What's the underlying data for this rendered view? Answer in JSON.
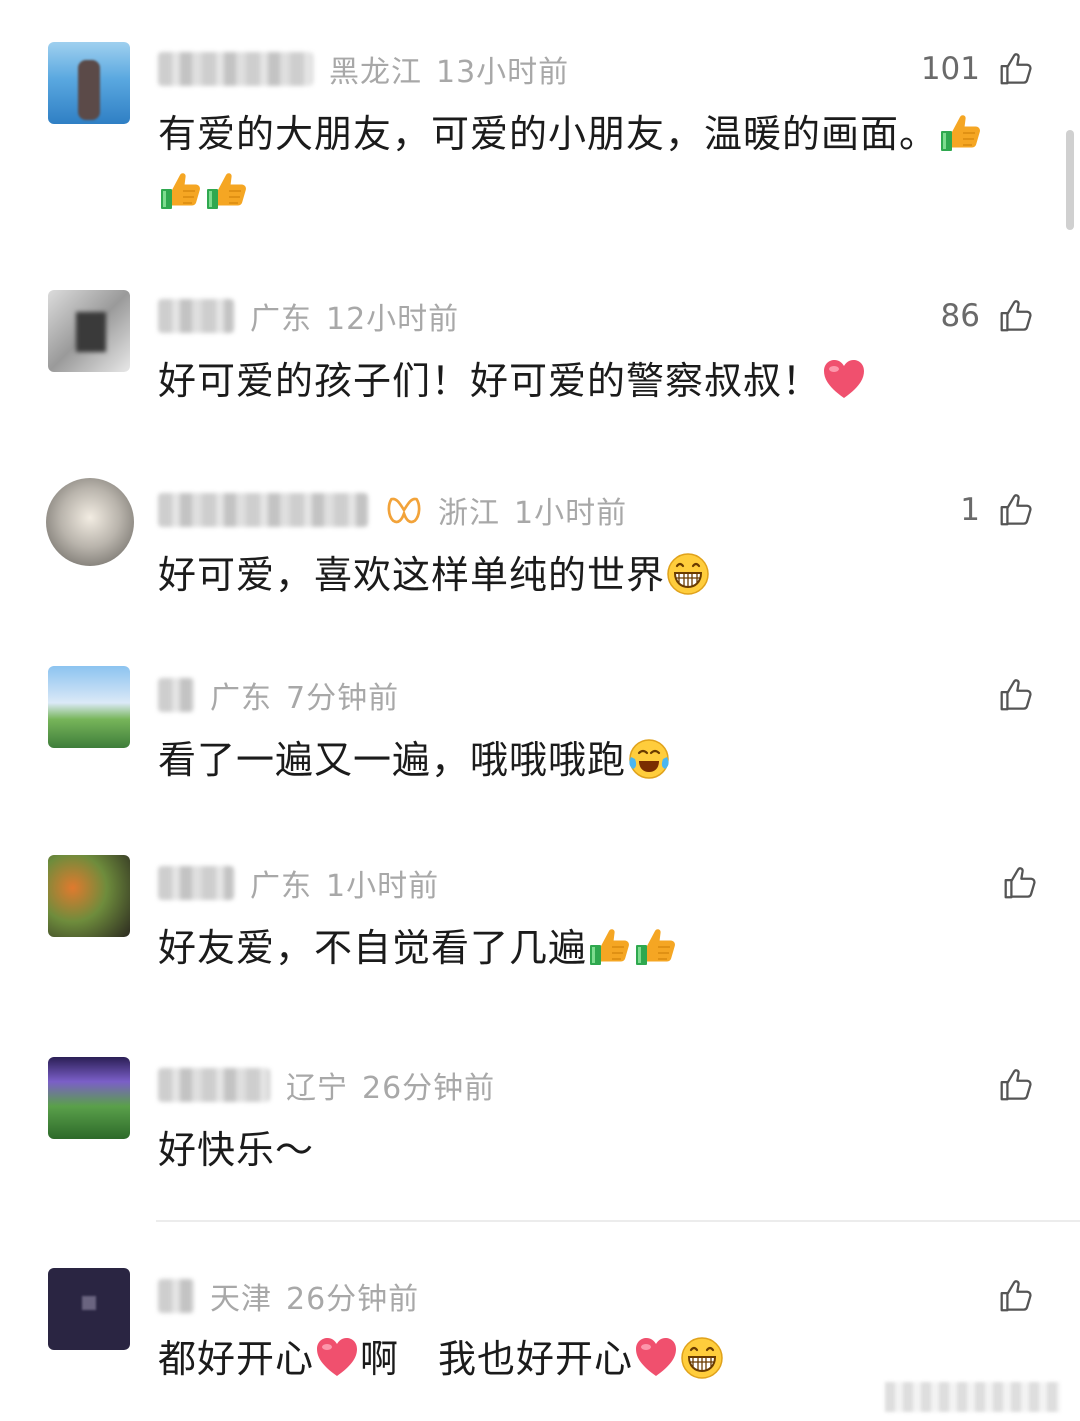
{
  "comments": [
    {
      "region": "黑龙江",
      "time": "13小时前",
      "likes": "101",
      "text": "有爱的大朋友，可爱的小朋友，温暖的画面。",
      "emojis": [
        "thumbs-up-emoji",
        "thumbs-up-emoji",
        "thumbs-up-emoji"
      ]
    },
    {
      "region": "广东",
      "time": "12小时前",
      "likes": "86",
      "text": "好可爱的孩子们！好可爱的警察叔叔！",
      "emojis": [
        "heart-emoji"
      ]
    },
    {
      "region": "浙江",
      "time": "1小时前",
      "likes": "1",
      "text": "好可爱，喜欢这样单纯的世界",
      "emojis": [
        "grin-emoji"
      ]
    },
    {
      "region": "广东",
      "time": "7分钟前",
      "likes": "",
      "text": "看了一遍又一遍，哦哦哦跑",
      "emojis": [
        "laugh-cry-emoji"
      ]
    },
    {
      "region": "广东",
      "time": "1小时前",
      "likes": "",
      "text": "好友爱，不自觉看了几遍",
      "emojis": [
        "thumbs-up-emoji",
        "thumbs-up-emoji"
      ]
    },
    {
      "region": "辽宁",
      "time": "26分钟前",
      "likes": "",
      "text": "好快乐～",
      "emojis": []
    },
    {
      "region": "天津",
      "time": "26分钟前",
      "likes": "",
      "text_part1": "都好开心",
      "text_part2": "啊　我也好开心",
      "emojis": [
        "heart-emoji",
        "heart-emoji",
        "grin-emoji"
      ]
    }
  ],
  "colors": {
    "meta": "#a8a8a8",
    "text": "#1b1b1b",
    "like_count": "#6a6a6a",
    "heart": "#f0506e",
    "thumb": "#f5a623",
    "cuff": "#2fa84f"
  }
}
